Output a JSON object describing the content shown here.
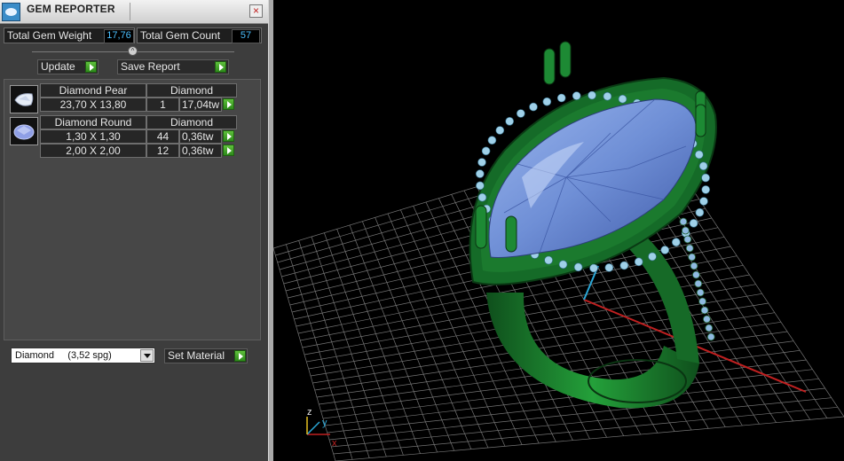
{
  "window": {
    "title": "GEM REPORTER",
    "close_icon": "close-icon"
  },
  "stats": {
    "total_weight_label": "Total Gem Weight",
    "total_weight_value": "17,76",
    "total_count_label": "Total Gem Count",
    "total_count_value": "57"
  },
  "toolbar": {
    "update_label": "Update",
    "save_report_label": "Save Report"
  },
  "gems": [
    {
      "name": "Diamond Pear",
      "material": "Diamond",
      "icon": "pear-gem-icon",
      "rows": [
        {
          "size": "23,70 X 13,80",
          "count": "1",
          "weight": "17,04tw"
        }
      ]
    },
    {
      "name": "Diamond Round",
      "material": "Diamond",
      "icon": "round-gem-icon",
      "rows": [
        {
          "size": "1,30 X 1,30",
          "count": "44",
          "weight": "0,36tw"
        },
        {
          "size": "2,00 X 2,00",
          "count": "12",
          "weight": "0,36tw"
        }
      ]
    }
  ],
  "material_select": {
    "selected": "Diamond     (3,52 spg)"
  },
  "set_material_label": "Set Material",
  "viewport": {
    "axes": {
      "x": "x",
      "y": "y",
      "z": "z"
    },
    "colors": {
      "metal": "#1b7a2e",
      "stone": "#6f8fd6",
      "grid": "#8a8a8a",
      "x_axis": "#c02020",
      "y_axis": "#2aa8d8"
    }
  }
}
